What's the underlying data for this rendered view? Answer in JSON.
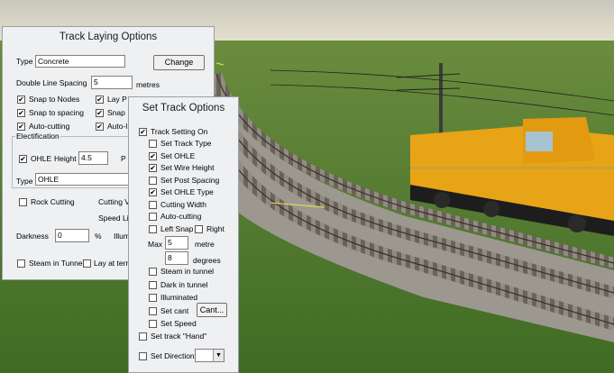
{
  "track_laying": {
    "title": "Track Laying Options",
    "type_label": "Type",
    "type_value": "Concrete",
    "change_button": "Change",
    "double_line_label": "Double Line Spacing",
    "double_line_value": "5",
    "metres_unit": "metres",
    "snap_nodes": "Snap to Nodes",
    "snap_spacing": "Snap to spacing",
    "auto_cutting": "Auto-cutting",
    "lay_partial": "Lay P",
    "snap_partial": "Snap",
    "auto_partial": "Auto-l",
    "electrification_label": "Electification",
    "ohle_label": "OHLE",
    "height_label": "Height",
    "height_value": "4.5",
    "p_partial": "P",
    "type2_label": "Type",
    "type2_value": "OHLE",
    "rock_cutting": "Rock Cutting",
    "cutting_partial": "Cutting V",
    "speed_partial": "Speed Li",
    "darkness_label": "Darkness",
    "darkness_value": "0",
    "percent_unit": "%",
    "illum_partial": "Illum",
    "steam_tunnel": "Steam in Tunnel",
    "lay_at_term": "Lay at tern"
  },
  "set_track": {
    "title": "Set Track Options",
    "track_setting_on": "Track Setting On",
    "set_track_type": "Set Track Type",
    "set_ohle": "Set OHLE",
    "set_wire_height": "Set Wire Height",
    "set_post_spacing": "Set Post Spacing",
    "set_ohle_type": "Set OHLE Type",
    "cutting_width": "Cutting Width",
    "auto_cutting": "Auto-cutting",
    "left_snap": "Left Snap",
    "right": "Right",
    "max_label": "Max",
    "max_value": "5",
    "metre_unit": "metre",
    "degrees_value": "8",
    "degrees_unit": "degrees",
    "steam_in_tunnel": "Steam in tunnel",
    "dark_in_tunnel": "Dark in tunnel",
    "illuminated": "Illuminated",
    "set_cant": "Set cant",
    "cant_button": "Cant...",
    "set_speed": "Set Speed",
    "set_track_hand": "Set track \"Hand\"",
    "set_direction": "Set Direction"
  },
  "checks": {
    "snap_nodes": true,
    "snap_spacing": true,
    "auto_cutting": true,
    "lay_partial": true,
    "snap_partial": true,
    "auto_partial": true,
    "ohle": true,
    "rock_cutting": false,
    "steam_tunnel": false,
    "lay_at_term": false,
    "track_setting_on": true,
    "set_track_type": false,
    "set_ohle": true,
    "set_wire_height": true,
    "set_post_spacing": false,
    "set_ohle_type": true,
    "cutting_width": false,
    "auto_cutting2": false,
    "left_snap": false,
    "right": false,
    "steam_in_tunnel": false,
    "dark_in_tunnel": false,
    "illuminated": false,
    "set_cant": false,
    "set_speed": false,
    "set_track_hand": false,
    "set_direction": false
  },
  "colors": {
    "sky": "#d8d4c8",
    "grass": "#4f7a2e",
    "ballast": "#9a978f",
    "loco": "#e8a417",
    "panel": "#eef0f2"
  }
}
